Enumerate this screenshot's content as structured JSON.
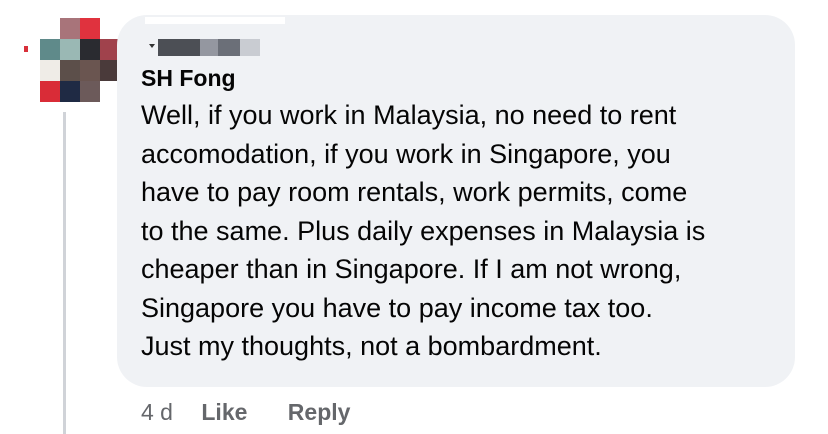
{
  "comment": {
    "author": "SH Fong",
    "lines": [
      "Well, if you work in Malaysia, no need to rent",
      "accomodation, if you work in Singapore, you",
      "have to pay room rentals, work permits, come",
      "to the same. Plus daily expenses in Malaysia is",
      "cheaper than in Singapore. If I am not wrong,",
      "Singapore you have to pay income tax too.",
      "Just my thoughts, not a bombardment."
    ]
  },
  "actions": {
    "timestamp": "4 d",
    "like_label": "Like",
    "reply_label": "Reply"
  },
  "colors": {
    "bubble_bg": "#f0f2f5",
    "text": "#050505",
    "secondary_text": "#65676b",
    "thread_line": "#d0d3d8"
  }
}
